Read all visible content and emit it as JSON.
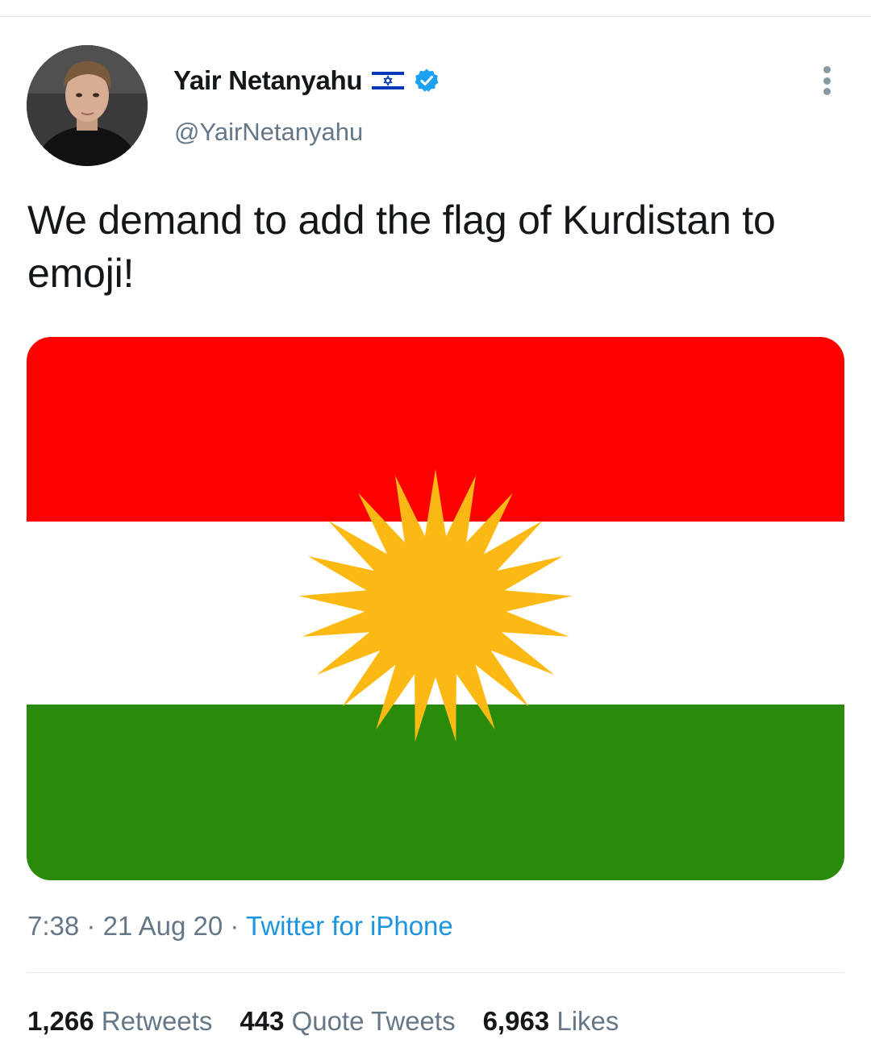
{
  "author": {
    "display_name": "Yair Netanyahu",
    "handle": "@YairNetanyahu",
    "verified": true,
    "name_emoji": "israel-flag-icon"
  },
  "tweet": {
    "text": "We demand to add the flag of Kurdistan to emoji!",
    "time": "7:38",
    "date": "21 Aug 20",
    "source": "Twitter for iPhone",
    "separator": "·"
  },
  "media": {
    "description": "flag-of-kurdistan-image",
    "colors": {
      "top_stripe": "#ff0000",
      "middle_stripe": "#ffffff",
      "bottom_stripe": "#2a8a0a",
      "sun": "#fdb913"
    },
    "sun_rays": 21
  },
  "stats": {
    "retweets_count": "1,266",
    "retweets_label": "Retweets",
    "quotes_count": "443",
    "quotes_label": "Quote Tweets",
    "likes_count": "6,963",
    "likes_label": "Likes"
  },
  "colors": {
    "accent": "#1b95e0",
    "verified": "#1da1f2",
    "secondary_text": "#657786"
  }
}
